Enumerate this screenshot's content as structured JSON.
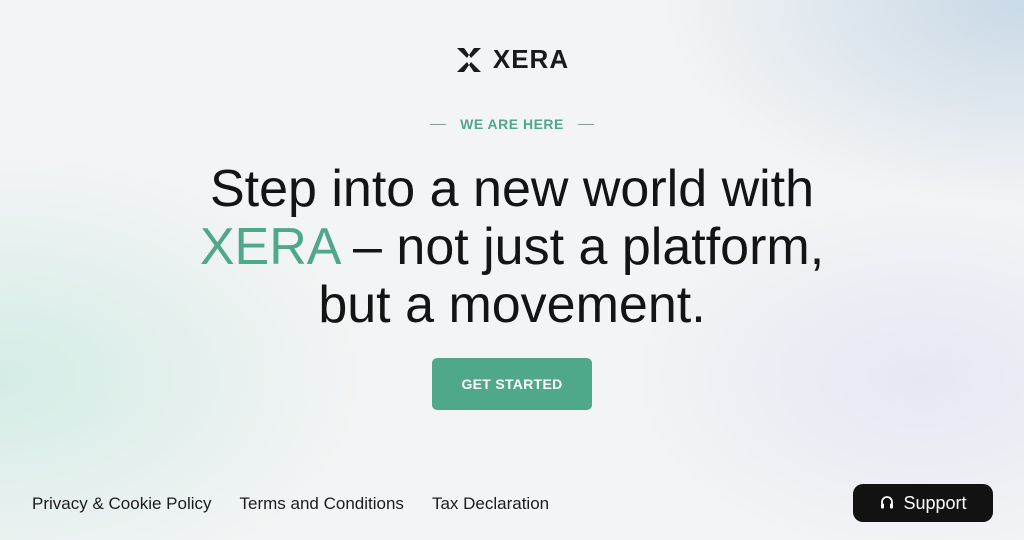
{
  "brand": {
    "name": "XERA",
    "logo_icon": "x-mark-logo-icon",
    "accent": "#4fa88a"
  },
  "hero": {
    "eyebrow": "WE ARE HERE",
    "headline_line1": "Step into a new world with",
    "headline_brand": "XERA",
    "headline_line2_rest": " – not just a platform,",
    "headline_line3": "but a movement.",
    "cta_label": "GET STARTED"
  },
  "footer": {
    "links": [
      "Privacy & Cookie Policy",
      "Terms and Conditions",
      "Tax Declaration"
    ]
  },
  "support": {
    "label": "Support",
    "icon": "headset-icon"
  }
}
